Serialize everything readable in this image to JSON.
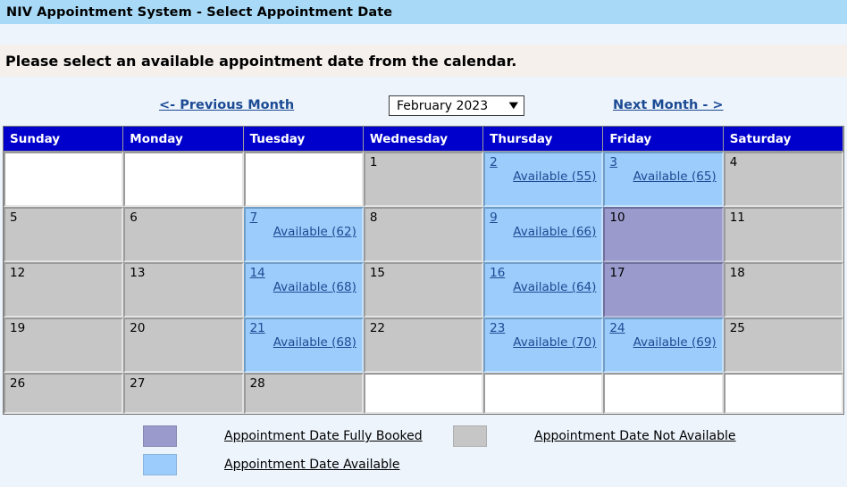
{
  "header": {
    "title": "NIV Appointment System - Select Appointment Date"
  },
  "instruction": {
    "text": "Please select an available appointment date from the calendar."
  },
  "nav": {
    "prev_label": "<- Previous Month",
    "next_label": "Next Month - >",
    "month_value": "February  2023",
    "chevron": "⌄"
  },
  "calendar": {
    "weekday_headers": [
      "Sunday",
      "Monday",
      "Tuesday",
      "Wednesday",
      "Thursday",
      "Friday",
      "Saturday"
    ],
    "weeks": [
      [
        {
          "state": "empty",
          "day": "",
          "link": ""
        },
        {
          "state": "empty",
          "day": "",
          "link": ""
        },
        {
          "state": "empty",
          "day": "",
          "link": ""
        },
        {
          "state": "unavailable",
          "day": "1",
          "link": ""
        },
        {
          "state": "available",
          "day": "2",
          "link": "Available (55)"
        },
        {
          "state": "available",
          "day": "3",
          "link": "Available (65)"
        },
        {
          "state": "unavailable",
          "day": "4",
          "link": ""
        }
      ],
      [
        {
          "state": "unavailable",
          "day": "5",
          "link": ""
        },
        {
          "state": "unavailable",
          "day": "6",
          "link": ""
        },
        {
          "state": "available",
          "day": "7",
          "link": "Available (62)"
        },
        {
          "state": "unavailable",
          "day": "8",
          "link": ""
        },
        {
          "state": "available",
          "day": "9",
          "link": "Available (66)"
        },
        {
          "state": "booked",
          "day": "10",
          "link": ""
        },
        {
          "state": "unavailable",
          "day": "11",
          "link": ""
        }
      ],
      [
        {
          "state": "unavailable",
          "day": "12",
          "link": ""
        },
        {
          "state": "unavailable",
          "day": "13",
          "link": ""
        },
        {
          "state": "available",
          "day": "14",
          "link": "Available (68)"
        },
        {
          "state": "unavailable",
          "day": "15",
          "link": ""
        },
        {
          "state": "available",
          "day": "16",
          "link": "Available (64)"
        },
        {
          "state": "booked",
          "day": "17",
          "link": ""
        },
        {
          "state": "unavailable",
          "day": "18",
          "link": ""
        }
      ],
      [
        {
          "state": "unavailable",
          "day": "19",
          "link": ""
        },
        {
          "state": "unavailable",
          "day": "20",
          "link": ""
        },
        {
          "state": "available",
          "day": "21",
          "link": "Available (68)"
        },
        {
          "state": "unavailable",
          "day": "22",
          "link": ""
        },
        {
          "state": "available",
          "day": "23",
          "link": "Available (70)"
        },
        {
          "state": "available",
          "day": "24",
          "link": "Available (69)"
        },
        {
          "state": "unavailable",
          "day": "25",
          "link": ""
        }
      ],
      [
        {
          "state": "unavailable",
          "day": "26",
          "link": ""
        },
        {
          "state": "unavailable",
          "day": "27",
          "link": ""
        },
        {
          "state": "unavailable",
          "day": "28",
          "link": ""
        },
        {
          "state": "empty",
          "day": "",
          "link": ""
        },
        {
          "state": "empty",
          "day": "",
          "link": ""
        },
        {
          "state": "empty",
          "day": "",
          "link": ""
        },
        {
          "state": "empty",
          "day": "",
          "link": ""
        }
      ]
    ]
  },
  "legend": {
    "booked_label": "Appointment Date Fully Booked",
    "available_label": "Appointment Date Available",
    "unavailable_label": "Appointment Date Not Available"
  },
  "colors": {
    "title_bar": "#a8daf7",
    "page_background": "#edf4fc",
    "header_cell": "#0000cc",
    "link": "#1c4b94",
    "available": "#9cccfb",
    "booked": "#9a9acd",
    "unavailable": "#c6c6c6"
  }
}
